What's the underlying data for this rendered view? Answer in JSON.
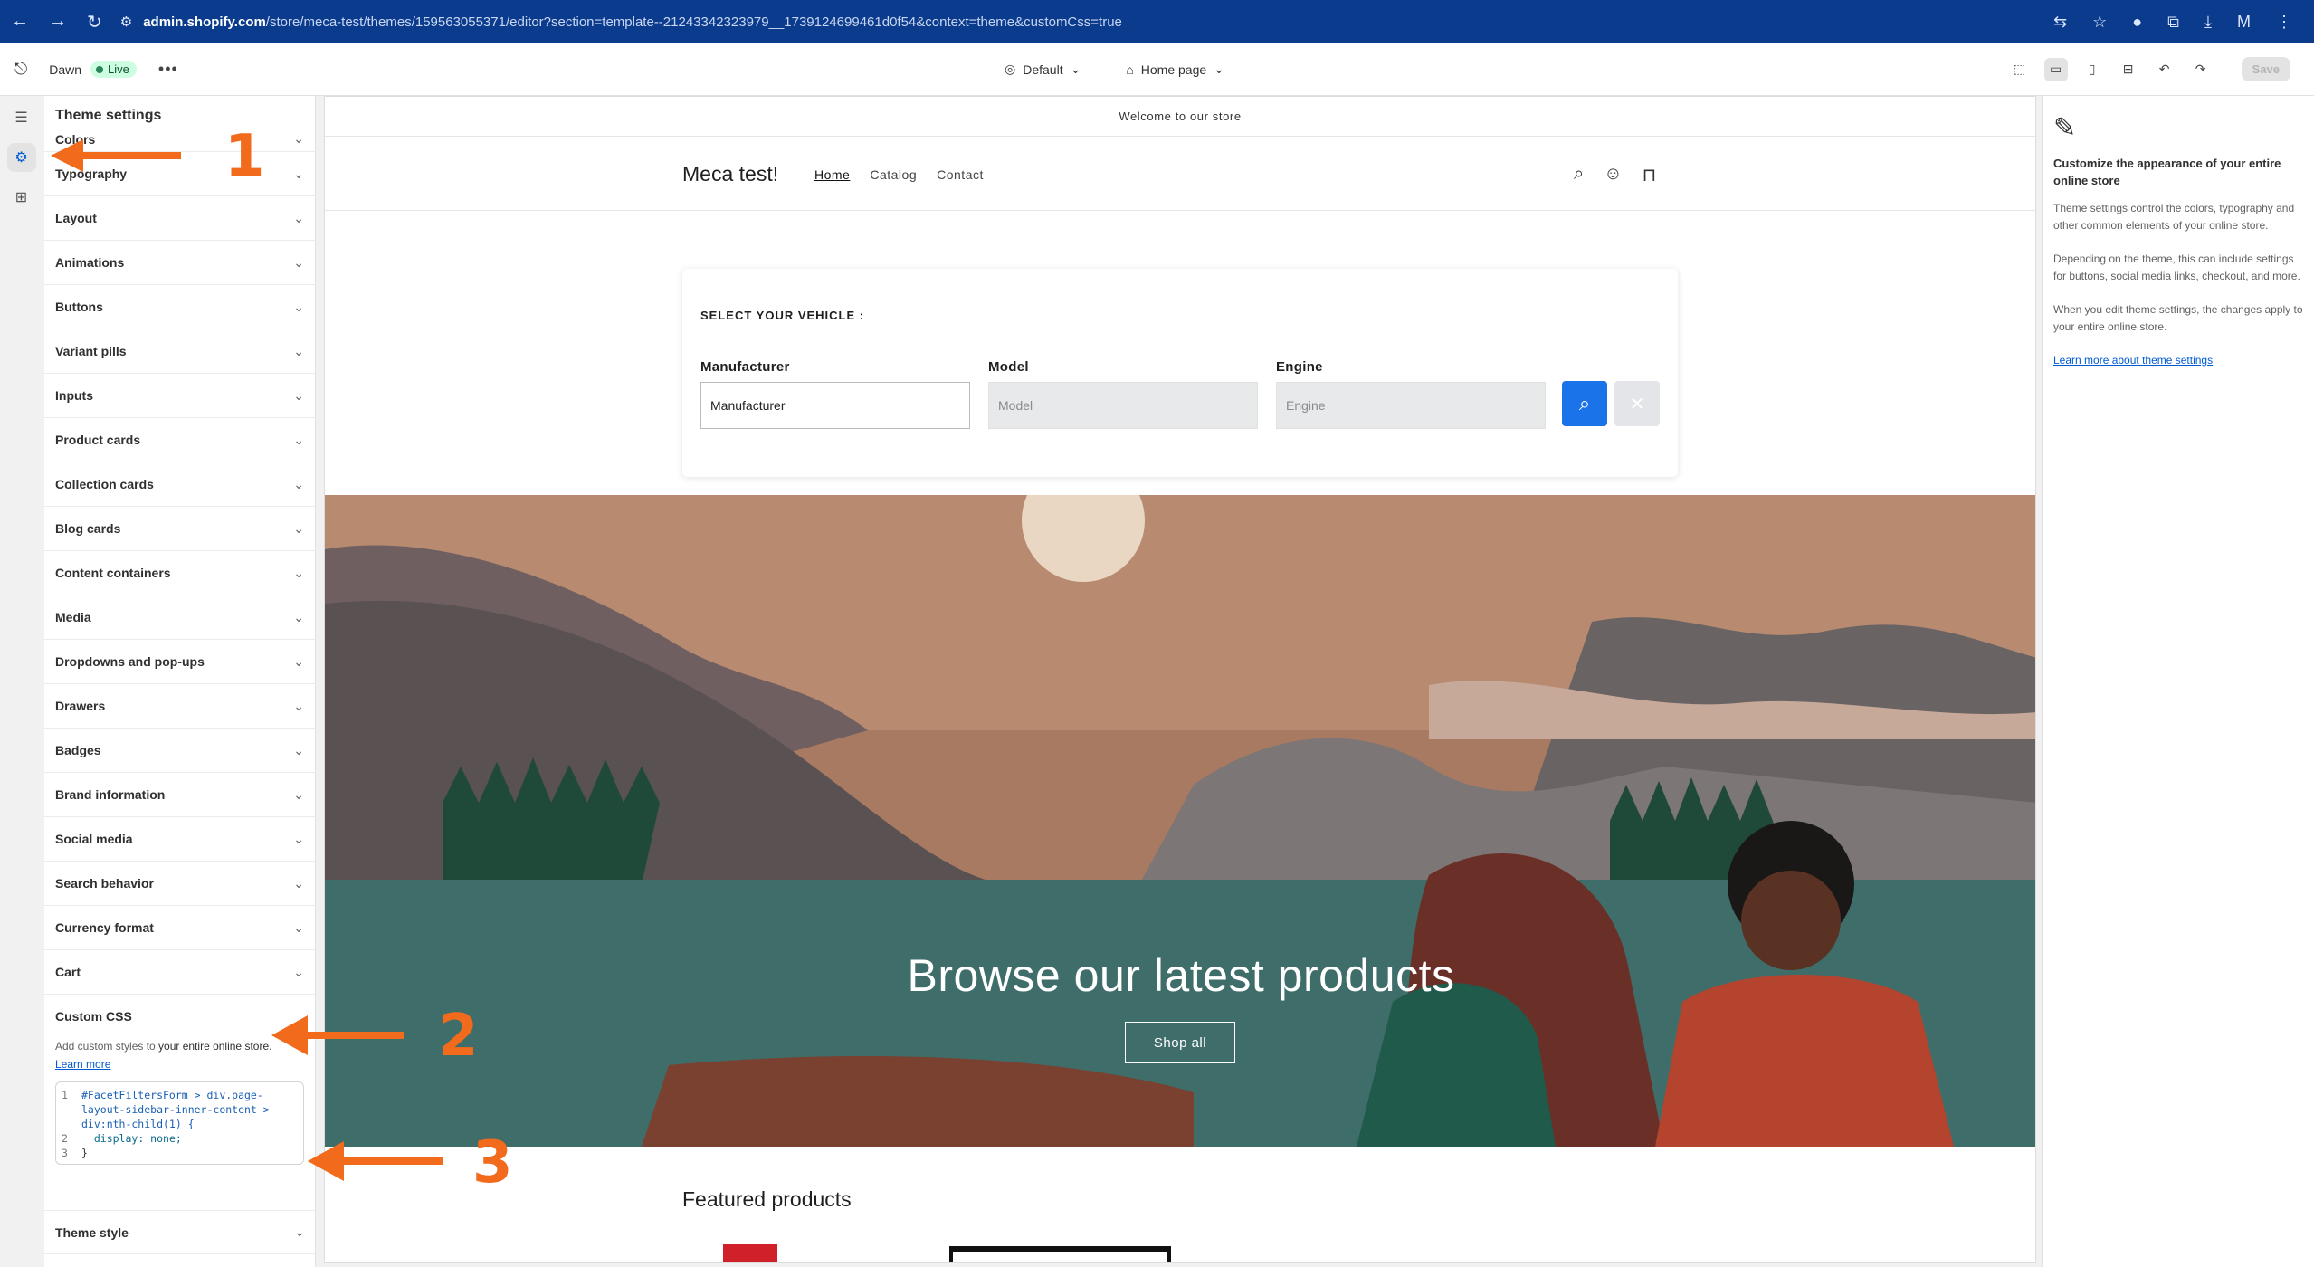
{
  "browser": {
    "url_host": "admin.shopify.com",
    "url_rest": "/store/meca-test/themes/159563055371/editor?section=template--21243342323979__1739124699461d0f54&context=theme&customCss=true"
  },
  "topbar": {
    "theme_name": "Dawn",
    "live_label": "Live",
    "view_label": "Default",
    "page_label": "Home page",
    "save_label": "Save"
  },
  "panel": {
    "title": "Theme settings",
    "sections": [
      "Colors",
      "Typography",
      "Layout",
      "Animations",
      "Buttons",
      "Variant pills",
      "Inputs",
      "Product cards",
      "Collection cards",
      "Blog cards",
      "Content containers",
      "Media",
      "Dropdowns and pop-ups",
      "Drawers",
      "Badges",
      "Brand information",
      "Social media",
      "Search behavior",
      "Currency format",
      "Cart"
    ],
    "custom_css": {
      "title": "Custom CSS",
      "help_prefix": "Add custom styles to ",
      "help_bold": "your entire online store.",
      "learn_more": "Learn more",
      "code_line1_num": "1",
      "code_line1a": "#FacetFiltersForm > div.page-",
      "code_line1b": "layout-sidebar-inner-content >",
      "code_line1c": "div:nth-child(1) {",
      "code_line2_num": "2",
      "code_line2": "display: none;",
      "code_line3_num": "3",
      "code_line3": "}"
    },
    "last_section": "Theme style"
  },
  "store": {
    "announcement": "Welcome to our store",
    "name": "Meca test!",
    "nav": [
      "Home",
      "Catalog",
      "Contact"
    ],
    "vehicle": {
      "title": "SELECT YOUR VEHICLE :",
      "manufacturer_label": "Manufacturer",
      "manufacturer_value": "Manufacturer",
      "model_label": "Model",
      "model_value": "Model",
      "engine_label": "Engine",
      "engine_value": "Engine"
    },
    "hero_title": "Browse our latest products",
    "hero_button": "Shop all",
    "featured_title": "Featured products"
  },
  "info": {
    "title": "Customize the appearance of your entire online store",
    "p1": "Theme settings control the colors, typography and other common elements of your online store.",
    "p2": "Depending on the theme, this can include settings for buttons, social media links, checkout, and more.",
    "p3": "When you edit theme settings, the changes apply to your entire online store.",
    "link": "Learn more about theme settings"
  },
  "annotations": [
    "1",
    "2",
    "3"
  ],
  "colors": {
    "annotation": "#f26a1b",
    "browser_bar": "#0b3b8c",
    "search_button": "#1a73e8"
  }
}
